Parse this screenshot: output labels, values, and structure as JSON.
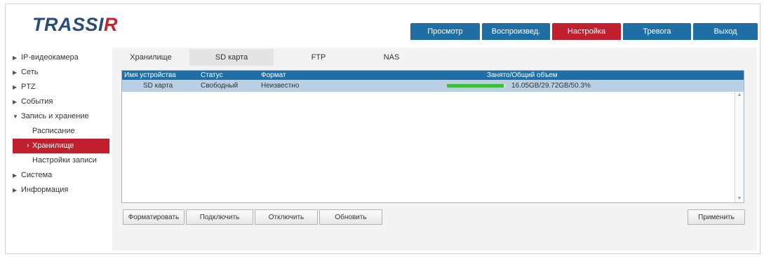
{
  "logo": {
    "text_main": "TRASSI",
    "text_accent": "R"
  },
  "topnav": {
    "tabs": [
      {
        "label": "Просмотр",
        "active": false
      },
      {
        "label": "Воспроизвед.",
        "active": false
      },
      {
        "label": "Настройка",
        "active": true
      },
      {
        "label": "Тревога",
        "active": false
      },
      {
        "label": "Выход",
        "active": false
      }
    ]
  },
  "sidebar": {
    "items": [
      {
        "label": "IP-видеокамера",
        "arrow": "▶"
      },
      {
        "label": "Сеть",
        "arrow": "▶"
      },
      {
        "label": "PTZ",
        "arrow": "▶"
      },
      {
        "label": "События",
        "arrow": "▶"
      },
      {
        "label": "Запись и хранение",
        "arrow": "▼"
      }
    ],
    "sub_items": [
      {
        "label": "Расписание",
        "active": false
      },
      {
        "label": "Хранилище",
        "active": true,
        "marker": "›"
      },
      {
        "label": "Настройки записи",
        "active": false
      }
    ],
    "items_after": [
      {
        "label": "Система",
        "arrow": "▶"
      },
      {
        "label": "Информация",
        "arrow": "▶"
      }
    ]
  },
  "subtabs": [
    {
      "label": "Хранилище",
      "active": false
    },
    {
      "label": "SD карта",
      "active": true
    },
    {
      "label": "FTP",
      "active": false
    },
    {
      "label": "NAS",
      "active": false
    }
  ],
  "grid": {
    "columns": [
      "Имя устройства",
      "Статус",
      "Формат",
      "Занято/Общий объем"
    ],
    "rows": [
      {
        "name": "SD карта",
        "status": "Свободный",
        "format": "Неизвестно",
        "usage": "16.05GB/29.72GB/50.3%",
        "progress_fraction": 0.97
      }
    ]
  },
  "scrollbar": {
    "up": "▲",
    "down": "▼"
  },
  "buttons": {
    "b0": "Форматировать",
    "b1": "Подключить",
    "b2": "Отключить",
    "b3": "Обновить",
    "refresh": "Применить"
  }
}
